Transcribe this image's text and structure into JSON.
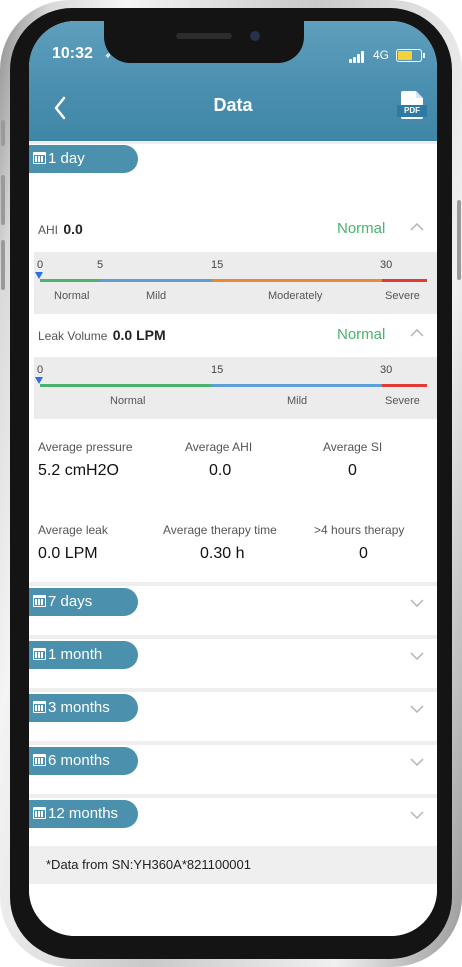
{
  "status_bar": {
    "time": "10:32",
    "location_glyph": "➶",
    "network": "4G"
  },
  "header": {
    "title": "Data",
    "pdf_label": "PDF",
    "accent_color": "#4b8fb0"
  },
  "one_day": {
    "range_label": "1 day",
    "ahi": {
      "label": "AHI",
      "value": "0.0",
      "status": "Normal",
      "ticks": [
        "0",
        "5",
        "15",
        "30"
      ],
      "categories": [
        "Normal",
        "Mild",
        "Moderately",
        "Severe"
      ]
    },
    "leak": {
      "label": "Leak Volume",
      "value": "0.0 LPM",
      "status": "Normal",
      "ticks": [
        "0",
        "15",
        "30"
      ],
      "categories": [
        "Normal",
        "Mild",
        "Severe"
      ]
    },
    "stats": [
      {
        "label": "Average pressure",
        "value": "5.2 cmH2O"
      },
      {
        "label": "Average AHI",
        "value": "0.0"
      },
      {
        "label": "Average SI",
        "value": "0"
      },
      {
        "label": "Average leak",
        "value": "0.0 LPM"
      },
      {
        "label": "Average therapy time",
        "value": "0.30 h"
      },
      {
        "label": ">4 hours therapy",
        "value": "0"
      }
    ]
  },
  "ranges": [
    {
      "label": "7 days"
    },
    {
      "label": "1 month"
    },
    {
      "label": "3 months"
    },
    {
      "label": "6 months"
    },
    {
      "label": "12 months"
    }
  ],
  "footer": {
    "note": "*Data from SN:YH360A*821100001"
  },
  "colors": {
    "normal": "#49b36f",
    "mild": "#5b9fd6",
    "moderate": "#e8893a",
    "severe": "#e03a35"
  }
}
